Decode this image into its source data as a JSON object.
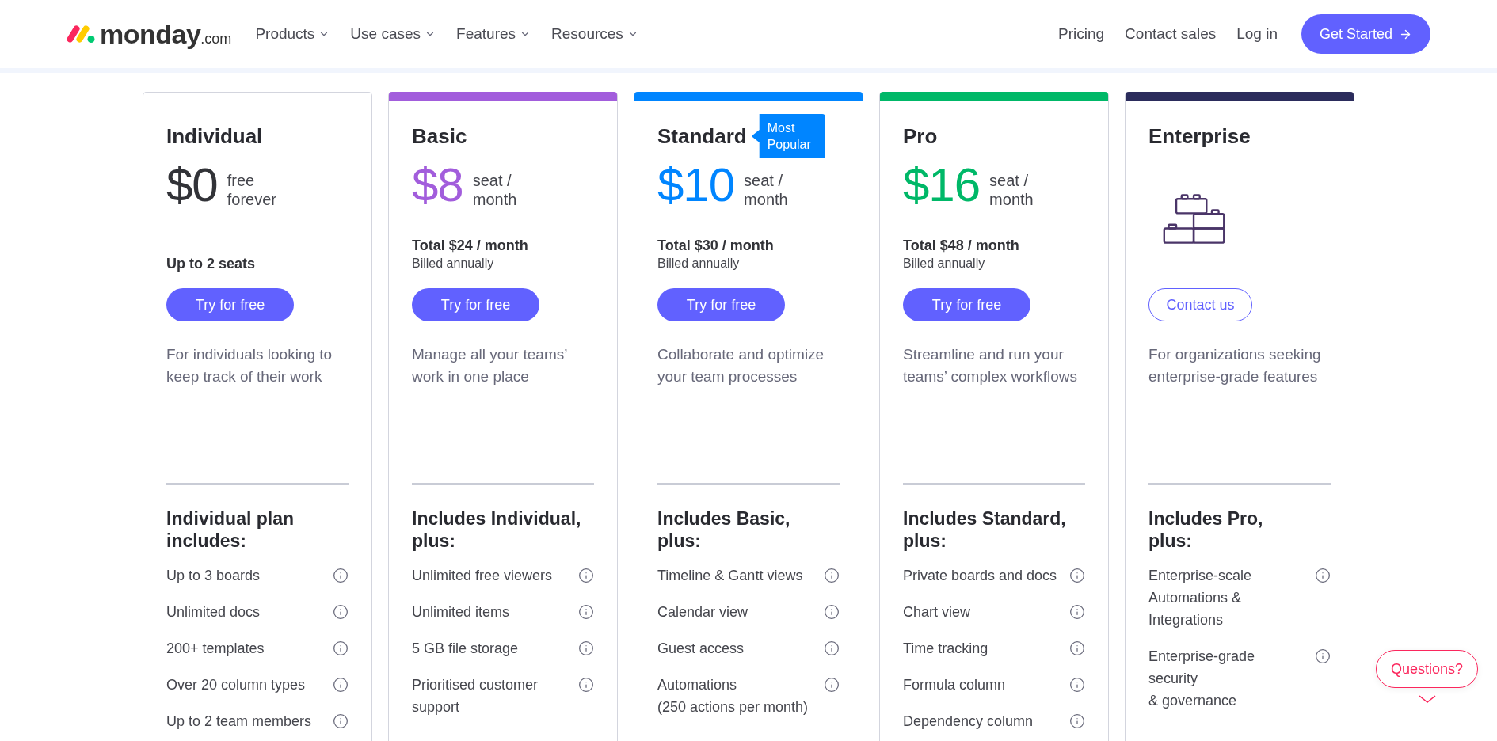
{
  "header": {
    "logo": {
      "wordmark": "monday",
      "suffix": ".com"
    },
    "menus": [
      {
        "label": "Products"
      },
      {
        "label": "Use cases"
      },
      {
        "label": "Features"
      },
      {
        "label": "Resources"
      }
    ],
    "links": [
      "Pricing",
      "Contact sales",
      "Log in"
    ],
    "cta": "Get Started"
  },
  "plans": [
    {
      "kind": "free",
      "name": "Individual",
      "price": "$0",
      "price_note": "free\nforever",
      "seats": "Up to 2 seats",
      "button": "Try for free",
      "description": "For individuals looking to keep track of their work",
      "features_title": "Individual plan\nincludes:",
      "features": [
        "Up to 3 boards",
        "Unlimited docs",
        "200+ templates",
        "Over 20 column types",
        "Up to 2 team members"
      ]
    },
    {
      "kind": "paid",
      "name": "Basic",
      "color": "#a25ddc",
      "price": "$8",
      "price_note": "seat /\nmonth",
      "total": "Total $24 / month",
      "billing": "Billed annually",
      "button": "Try for free",
      "description": "Manage all your teams’ work in one place",
      "features_title": "Includes Individual,\nplus:",
      "features": [
        "Unlimited free viewers",
        "Unlimited items",
        "5 GB file storage",
        "Prioritised customer support"
      ]
    },
    {
      "kind": "paid",
      "name": "Standard",
      "badge": "Most Popular",
      "color": "#0085ff",
      "price": "$10",
      "price_note": "seat /\nmonth",
      "total": "Total $30 / month",
      "billing": "Billed annually",
      "button": "Try for free",
      "description": "Collaborate and optimize your team processes",
      "features_title": "Includes Basic,\nplus:",
      "features": [
        "Timeline & Gantt views",
        "Calendar view",
        "Guest access",
        "Automations\n(250 actions per month)"
      ]
    },
    {
      "kind": "paid",
      "name": "Pro",
      "color": "#00b868",
      "price": "$16",
      "price_note": "seat /\nmonth",
      "total": "Total $48 / month",
      "billing": "Billed annually",
      "button": "Try for free",
      "description": "Streamline and run your teams’ complex workflows",
      "features_title": "Includes Standard,\nplus:",
      "features": [
        "Private boards and docs",
        "Chart view",
        "Time tracking",
        "Formula column",
        "Dependency column"
      ]
    },
    {
      "kind": "custom",
      "name": "Enterprise",
      "color": "#2b2c5c",
      "button": "Contact us",
      "description": "For organizations seeking enterprise-grade features",
      "features_title": "Includes Pro,\nplus:",
      "features": [
        "Enterprise-scale\nAutomations &\nIntegrations",
        "Enterprise-grade\nsecurity\n& governance"
      ]
    }
  ],
  "help_button": "Questions?"
}
